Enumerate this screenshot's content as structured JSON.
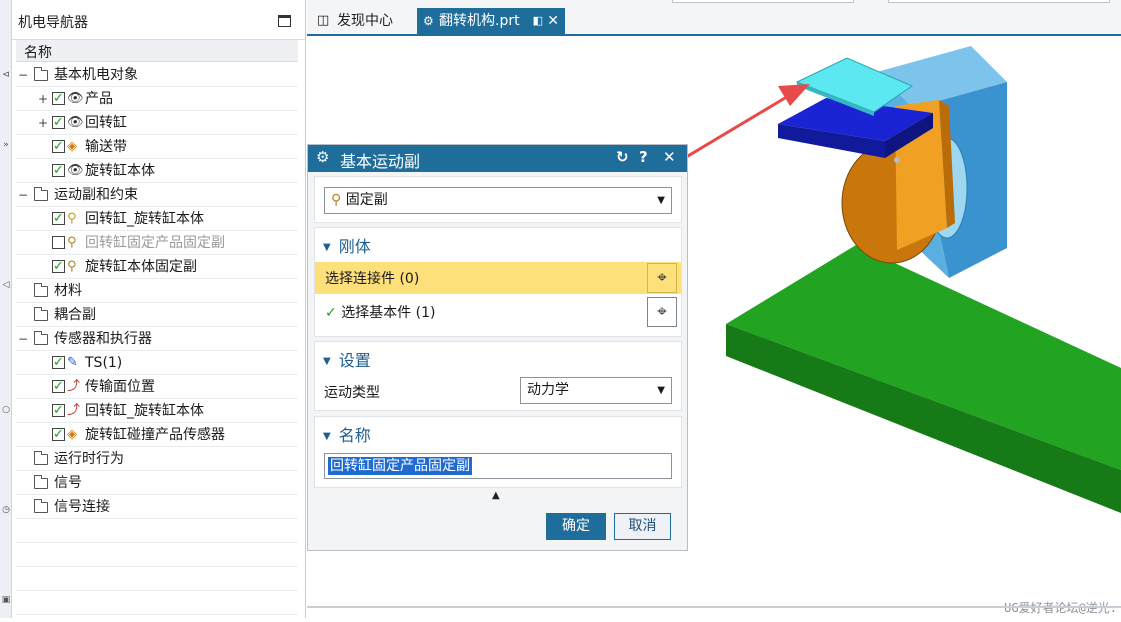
{
  "navigator": {
    "title": "机电导航器",
    "column_header": "名称",
    "items": [
      {
        "label": "基本机电对象",
        "level": 0,
        "expander": "−",
        "checked": null,
        "icon": "folder-icon"
      },
      {
        "label": "产品",
        "level": 1,
        "expander": "+",
        "checked": true,
        "icon": "eye-icon"
      },
      {
        "label": "回转缸",
        "level": 1,
        "expander": "+",
        "checked": true,
        "icon": "eye-icon"
      },
      {
        "label": "输送带",
        "level": 1,
        "expander": "",
        "checked": true,
        "icon": "conveyor-icon"
      },
      {
        "label": "旋转缸本体",
        "level": 1,
        "expander": "",
        "checked": true,
        "icon": "eye-icon"
      },
      {
        "label": "运动副和约束",
        "level": 0,
        "expander": "−",
        "checked": null,
        "icon": "folder-icon"
      },
      {
        "label": "回转缸_旋转缸本体",
        "level": 1,
        "expander": "",
        "checked": true,
        "icon": "hinge-joint-icon"
      },
      {
        "label": "回转缸固定产品固定副",
        "level": 1,
        "expander": "",
        "checked": false,
        "icon": "fixed-joint-icon",
        "dim": true
      },
      {
        "label": "旋转缸本体固定副",
        "level": 1,
        "expander": "",
        "checked": true,
        "icon": "fixed-joint-icon"
      },
      {
        "label": "材料",
        "level": 0,
        "expander": "",
        "checked": null,
        "icon": "folder-icon"
      },
      {
        "label": "耦合副",
        "level": 0,
        "expander": "",
        "checked": null,
        "icon": "folder-icon"
      },
      {
        "label": "传感器和执行器",
        "level": 0,
        "expander": "−",
        "checked": null,
        "icon": "folder-icon"
      },
      {
        "label": "TS(1)",
        "level": 1,
        "expander": "",
        "checked": true,
        "icon": "sensor-icon"
      },
      {
        "label": "传输面位置",
        "level": 1,
        "expander": "",
        "checked": true,
        "icon": "position-control-icon"
      },
      {
        "label": "回转缸_旋转缸本体",
        "level": 1,
        "expander": "",
        "checked": true,
        "icon": "position-control-icon"
      },
      {
        "label": "旋转缸碰撞产品传感器",
        "level": 1,
        "expander": "",
        "checked": true,
        "icon": "collision-sensor-icon"
      },
      {
        "label": "运行时行为",
        "level": 0,
        "expander": "",
        "checked": null,
        "icon": "folder-icon"
      },
      {
        "label": "信号",
        "level": 0,
        "expander": "",
        "checked": null,
        "icon": "folder-icon"
      },
      {
        "label": "信号连接",
        "level": 0,
        "expander": "",
        "checked": null,
        "icon": "folder-icon"
      }
    ]
  },
  "tabs": [
    {
      "label": "发现中心",
      "active": false,
      "icon": "discovery-icon"
    },
    {
      "label": "翻转机构.prt",
      "active": true,
      "icon": "part-file-icon"
    }
  ],
  "dialog": {
    "title": "基本运动副",
    "joint_type": "固定副",
    "rigid_section": {
      "title": "刚体",
      "select_attachment": "选择连接件 (0)",
      "select_base": "选择基本件 (1)"
    },
    "settings_section": {
      "title": "设置",
      "motion_type_label": "运动类型",
      "motion_type_value": "动力学"
    },
    "name_section": {
      "title": "名称",
      "name_value": "回转缸固定产品固定副"
    },
    "ok_label": "确定",
    "cancel_label": "取消"
  },
  "watermark": "UG爱好者论坛@逆光.",
  "colors": {
    "accent": "#1f6d9b",
    "highlight": "#fde07a",
    "conveyor": "#1f9a1f",
    "product": "#5ce8f0",
    "plate": "#1b24d4",
    "cylinder": "#e88d12",
    "bracket": "#5aaee0"
  }
}
